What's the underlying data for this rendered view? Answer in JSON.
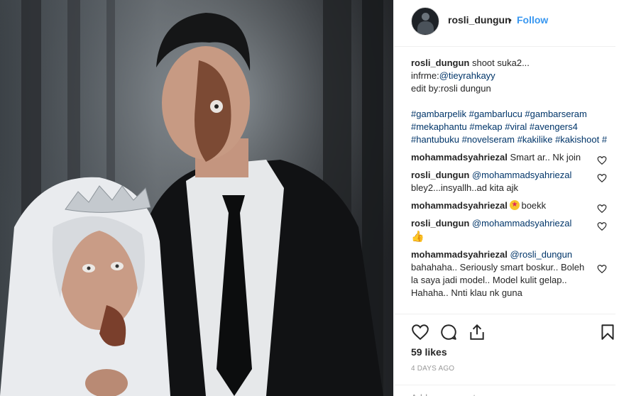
{
  "post": {
    "image_alt": "photo"
  },
  "header": {
    "username": "rosli_dungun",
    "separator": "•",
    "follow_label": "Follow"
  },
  "caption": {
    "username": "rosli_dungun",
    "text": "shoot suka2...",
    "line2_prefix": "infrme:",
    "line2_mention": "@tieyrahkayy",
    "line3": "edit by:rosli dungun",
    "hashtags": "#gambarpelik #gambarlucu #gambarseram #mekaphantu #mekap #viral #avengers4 #hantubuku #novelseram #kakilike #kakishoot #"
  },
  "comments": [
    {
      "username": "mohammadsyahriezal",
      "mention": "",
      "text": "Smart ar.. Nk join"
    },
    {
      "username": "rosli_dungun",
      "mention": "@mohammadsyahriezal",
      "text": "bley2...insyallh..ad kita ajk"
    },
    {
      "username": "mohammadsyahriezal",
      "mention": "",
      "text": "boekk"
    },
    {
      "username": "rosli_dungun",
      "mention": "@mohammadsyahriezal",
      "text": ""
    },
    {
      "username": "mohammadsyahriezal",
      "mention": "@rosli_dungun",
      "text": "bahahaha.. Seriously smart boskur.. Boleh la saya jadi model.. Model kulit gelap.. Hahaha.. Nnti klau nk guna"
    }
  ],
  "actions": {
    "like_icon": "heart-icon",
    "comment_icon": "comment-icon",
    "share_icon": "share-icon",
    "save_icon": "bookmark-icon"
  },
  "likes": "59 likes",
  "timestamp": "4 DAYS AGO",
  "add_comment": {
    "placeholder": "Add a comment..."
  },
  "colors": {
    "link": "#3897f0",
    "mention": "#003569",
    "text": "#262626",
    "muted": "#999999"
  }
}
